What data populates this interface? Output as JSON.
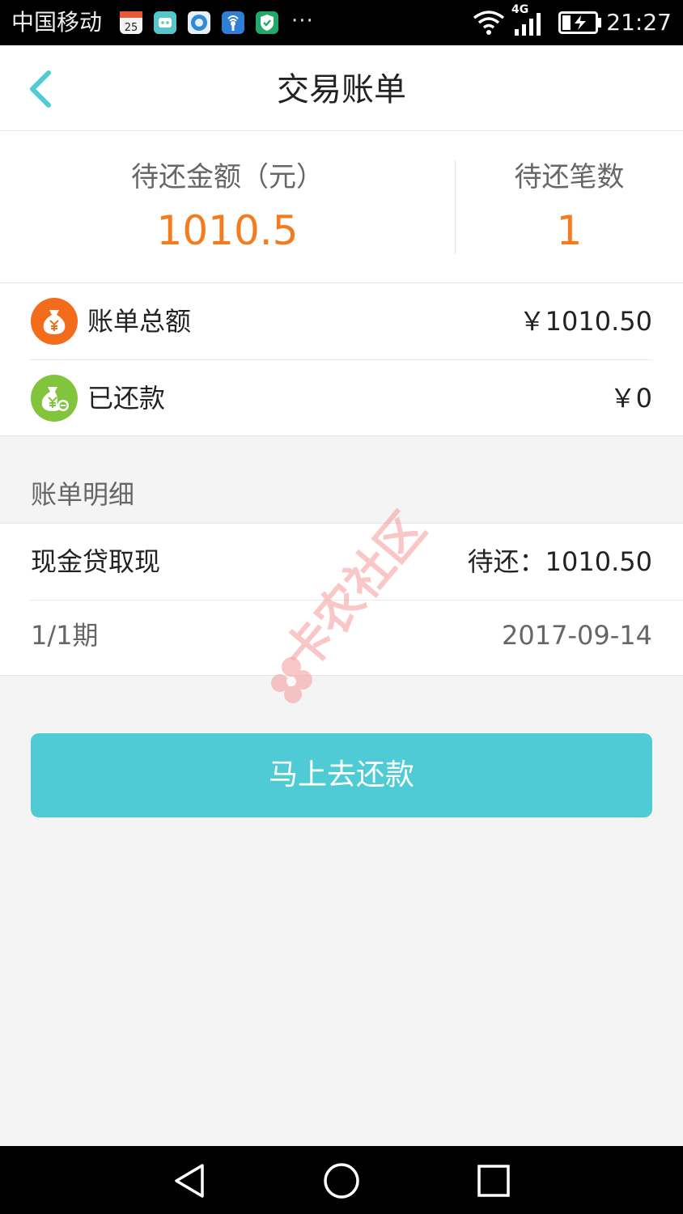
{
  "status_bar": {
    "carrier": "中国移动",
    "network": "4G",
    "time": "21:27",
    "more": "···",
    "calendar_day": "25",
    "notification_icons": [
      "calendar-icon",
      "chat-bot-icon",
      "browser-icon",
      "wifi-hotspot-icon",
      "shield-icon"
    ]
  },
  "header": {
    "title": "交易账单",
    "back_icon": "chevron-left-icon"
  },
  "summary": {
    "pending_amount_label": "待还金额（元）",
    "pending_amount_value": "1010.5",
    "pending_count_label": "待还笔数",
    "pending_count_value": "1"
  },
  "bill": {
    "total_label": "账单总额",
    "total_value": "￥1010.50",
    "repaid_label": "已还款",
    "repaid_value": "￥0"
  },
  "detail": {
    "section_title": "账单明细",
    "item_name": "现金贷取现",
    "item_status": "待还：1010.50",
    "period": "1/1期",
    "date": "2017-09-14"
  },
  "watermark": {
    "text": "卡农社区"
  },
  "action": {
    "repay_button": "马上去还款"
  },
  "colors": {
    "accent": "#4ecbd4",
    "amount": "#f47b1e",
    "total_icon": "#f36c1b",
    "repaid_icon": "#82c43c"
  }
}
